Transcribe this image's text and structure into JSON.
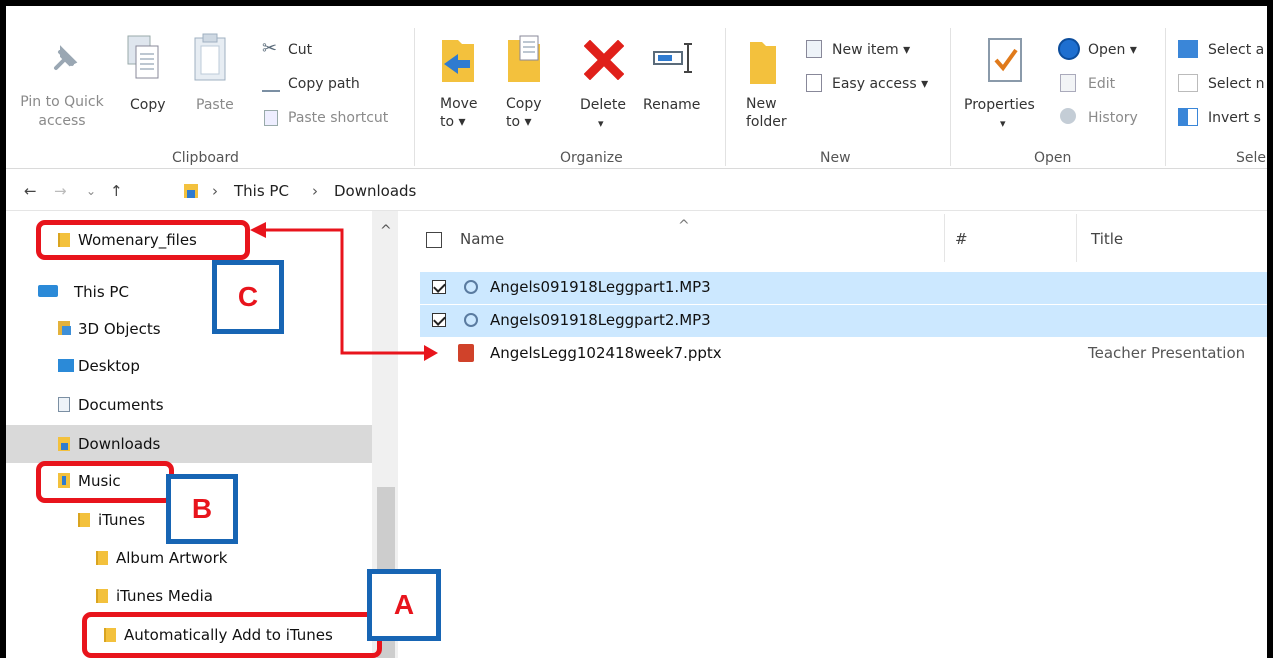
{
  "ribbon": {
    "clipboard": {
      "pin_label_line1": "Pin to Quick",
      "pin_label_line2": "access",
      "copy": "Copy",
      "paste": "Paste",
      "cut": "Cut",
      "copy_path": "Copy path",
      "paste_shortcut": "Paste shortcut",
      "group_label": "Clipboard"
    },
    "organize": {
      "move_to_line1": "Move",
      "move_to_line2": "to ▾",
      "copy_to_line1": "Copy",
      "copy_to_line2": "to ▾",
      "delete": "Delete",
      "delete_arrow": "▾",
      "rename": "Rename",
      "group_label": "Organize"
    },
    "new": {
      "new_folder_line1": "New",
      "new_folder_line2": "folder",
      "new_item": "New item ▾",
      "easy_access": "Easy access ▾",
      "group_label": "New"
    },
    "open": {
      "properties": "Properties",
      "properties_arrow": "▾",
      "open": "Open ▾",
      "edit": "Edit",
      "history": "History",
      "group_label": "Open"
    },
    "select": {
      "select_all": "Select a",
      "select_none": "Select n",
      "invert": "Invert s",
      "group_label": "Sele"
    }
  },
  "address": {
    "back": "←",
    "forward": "→",
    "recent": "⌄",
    "up": "↑",
    "sep1": "›",
    "crumb1": "This PC",
    "sep2": "›",
    "crumb2": "Downloads"
  },
  "nav": {
    "items": [
      {
        "label": "Womenary_files"
      },
      {
        "label": "This PC"
      },
      {
        "label": "3D Objects"
      },
      {
        "label": "Desktop"
      },
      {
        "label": "Documents"
      },
      {
        "label": "Downloads"
      },
      {
        "label": "Music"
      },
      {
        "label": "iTunes"
      },
      {
        "label": "Album Artwork"
      },
      {
        "label": "iTunes Media"
      },
      {
        "label": "Automatically Add to iTunes"
      }
    ],
    "scroll_up": "^"
  },
  "columns": {
    "sort_indicator": "^",
    "name": "Name",
    "number": "#",
    "title": "Title"
  },
  "files": [
    {
      "name": "Angels091918Leggpart1.MP3",
      "title": "",
      "checked": true,
      "selected": true
    },
    {
      "name": "Angels091918Leggpart2.MP3",
      "title": "",
      "checked": true,
      "selected": true
    },
    {
      "name": "AngelsLegg102418week7.pptx",
      "title": "Teacher Presentation",
      "checked": false,
      "selected": false
    }
  ],
  "annotations": {
    "a": "A",
    "b": "B",
    "c": "C"
  },
  "colors": {
    "annotation_red": "#e8141c",
    "annotation_blue": "#1765b4",
    "selection": "#cce8ff",
    "nav_selected": "#d9d9d9"
  }
}
